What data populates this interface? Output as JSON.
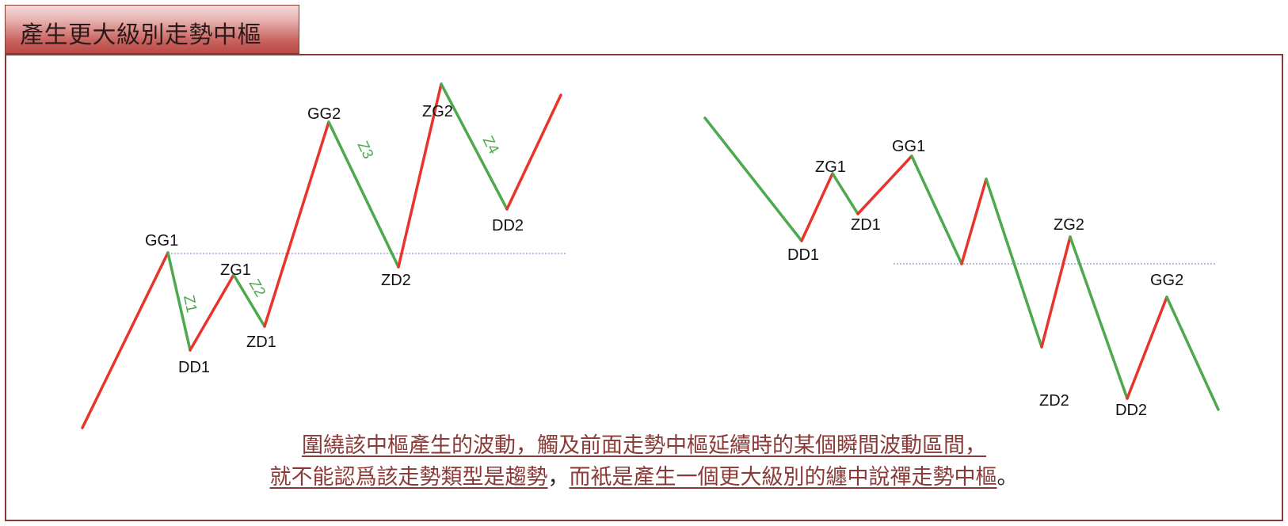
{
  "title": "產生更大級別走勢中樞",
  "colors": {
    "up": "#e8342a",
    "down": "#4ea84e",
    "label": "#111111",
    "zlabel": "#4ea84e",
    "caption": "#8a3a36",
    "dotted": "#6a7ec0"
  },
  "left_diagram": {
    "labels": [
      "GG1",
      "DD1",
      "ZG1",
      "ZD1",
      "GG2",
      "ZD2",
      "ZG2",
      "DD2"
    ],
    "segment_labels": [
      "Z1",
      "Z2",
      "Z3",
      "Z4"
    ]
  },
  "right_diagram": {
    "labels": [
      "DD1",
      "ZG1",
      "ZD1",
      "GG1",
      "ZG2",
      "ZD2",
      "DD2",
      "GG2"
    ]
  },
  "caption": {
    "line1": "圍繞該中樞產生的波動，觸及前面走勢中樞延續時的某個瞬間波動區間，",
    "line2_part1": "就不能認爲該走勢類型是趨勢",
    "line2_sep": "，",
    "line2_part2": "而衹是產生一個更大級別的纏中說禪走勢中樞",
    "line2_end": "。"
  }
}
